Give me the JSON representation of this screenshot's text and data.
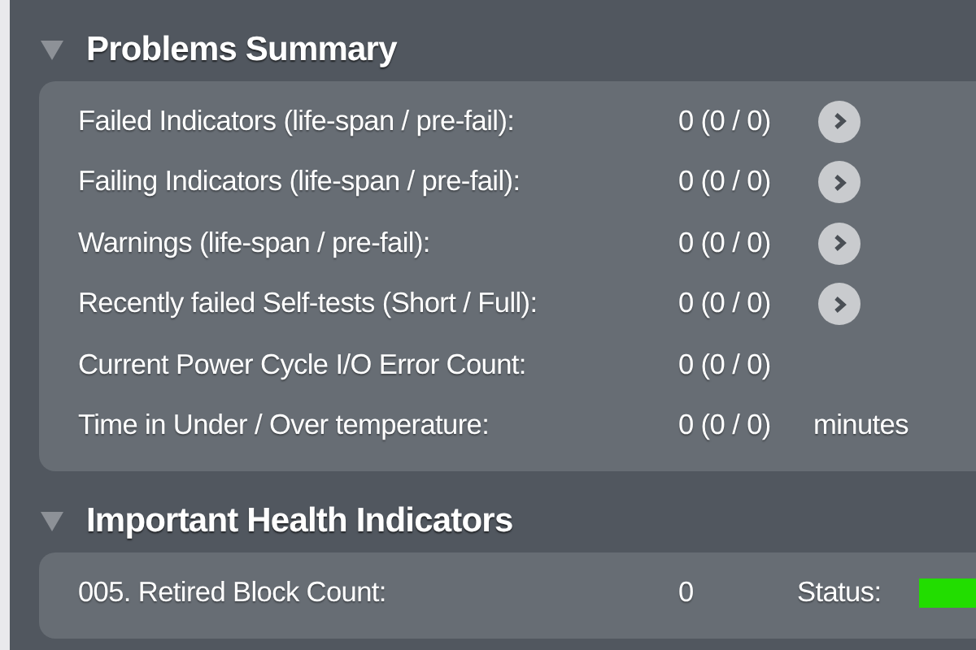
{
  "sections": [
    {
      "title": "Problems Summary",
      "expanded": true,
      "rows": [
        {
          "label": "Failed Indicators (life-span / pre-fail):",
          "value": "0 (0 / 0)",
          "has_details": true
        },
        {
          "label": "Failing Indicators (life-span / pre-fail):",
          "value": "0 (0 / 0)",
          "has_details": true
        },
        {
          "label": "Warnings (life-span / pre-fail):",
          "value": "0 (0 / 0)",
          "has_details": true
        },
        {
          "label": "Recently failed Self-tests (Short / Full):",
          "value": "0 (0 / 0)",
          "has_details": true
        },
        {
          "label": "Current Power Cycle I/O Error Count:",
          "value": "0 (0 / 0)",
          "has_details": false
        },
        {
          "label": "Time in Under / Over temperature:",
          "value": "0 (0 / 0)",
          "has_details": false,
          "unit": "minutes"
        }
      ]
    },
    {
      "title": "Important Health Indicators",
      "expanded": true,
      "rows": [
        {
          "label": "005. Retired Block Count:",
          "value": "0",
          "has_details": false,
          "status_label": "Status:",
          "color": "#22dd00"
        }
      ]
    }
  ]
}
